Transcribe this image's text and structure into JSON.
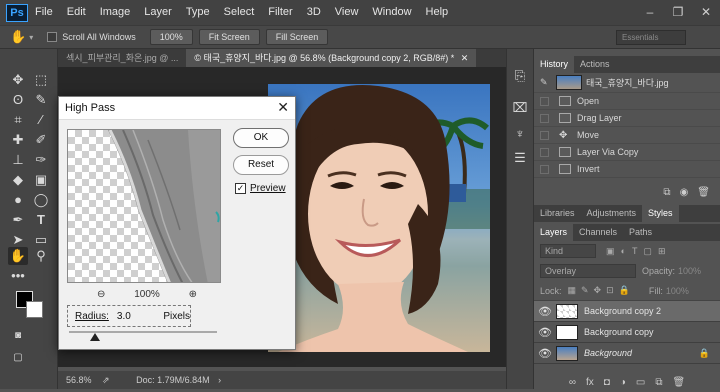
{
  "app": {
    "logo": "Ps"
  },
  "menu": [
    "File",
    "Edit",
    "Image",
    "Layer",
    "Type",
    "Select",
    "Filter",
    "3D",
    "View",
    "Window",
    "Help"
  ],
  "window_controls": [
    "–",
    "❐",
    "✕"
  ],
  "options": {
    "scroll_all": "Scroll All Windows",
    "zoom_100": "100%",
    "fit_screen": "Fit Screen",
    "fill_screen": "Fill Screen",
    "workspace": "Essentials"
  },
  "doc_tabs": [
    {
      "label": "섹시_피부관리_화온.jpg @ ..."
    },
    {
      "label": "© 태국_휴양지_바다.jpg @ 56.8% (Background copy 2, RGB/8#) *",
      "close": "✕"
    }
  ],
  "status": {
    "zoom": "56.8%",
    "doc": "Doc: 1.79M/6.84M"
  },
  "dialog": {
    "title": "High Pass",
    "ok": "OK",
    "reset": "Reset",
    "preview_label": "Preview",
    "preview_checked": true,
    "zoom_pct": "100%",
    "zoom_out": "⊖",
    "zoom_in": "⊕",
    "radius_label": "Radius:",
    "radius_value": "3.0",
    "radius_unit": "Pixels",
    "close": "✕"
  },
  "history": {
    "tabs": [
      "History",
      "Actions"
    ],
    "snapshot": "태국_휴양지_바다.jpg",
    "items": [
      "Open",
      "Drag Layer",
      "Move",
      "Layer Via Copy",
      "Invert"
    ]
  },
  "panel_tabs2": [
    "Libraries",
    "Adjustments",
    "Styles"
  ],
  "layers": {
    "tabs": [
      "Layers",
      "Channels",
      "Paths"
    ],
    "kind": "Kind",
    "blend_mode": "Overlay",
    "opacity_label": "Opacity:",
    "opacity_value": "100%",
    "lock_label": "Lock:",
    "fill_label": "Fill:",
    "fill_value": "100%",
    "items": [
      {
        "name": "Background copy 2",
        "selected": true
      },
      {
        "name": "Background copy",
        "selected": false
      },
      {
        "name": "Background",
        "selected": false,
        "locked": true
      }
    ]
  }
}
